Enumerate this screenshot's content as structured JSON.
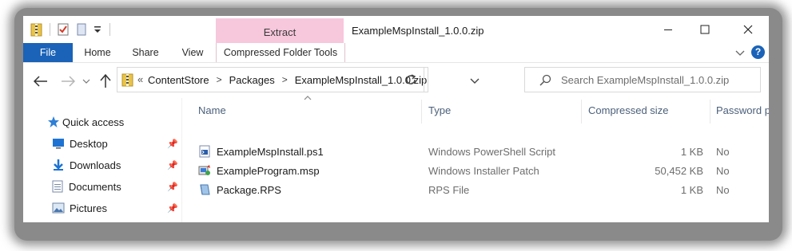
{
  "window": {
    "title": "ExampleMspInstall_1.0.0.zip",
    "context_tab_label": "Extract"
  },
  "ribbon": {
    "tabs": [
      "File",
      "Home",
      "Share",
      "View",
      "Compressed Folder Tools"
    ]
  },
  "address": {
    "overflow": "«",
    "crumbs": [
      "ContentStore",
      "Packages",
      "ExampleMspInstall_1.0.0.zip"
    ]
  },
  "search": {
    "placeholder": "Search ExampleMspInstall_1.0.0.zip"
  },
  "nav": {
    "items": [
      {
        "label": "Quick access",
        "icon": "star-icon"
      },
      {
        "label": "Desktop",
        "icon": "desktop-icon",
        "pinned": true
      },
      {
        "label": "Downloads",
        "icon": "download-icon",
        "pinned": true
      },
      {
        "label": "Documents",
        "icon": "documents-icon",
        "pinned": true
      },
      {
        "label": "Pictures",
        "icon": "pictures-icon",
        "pinned": true
      }
    ]
  },
  "columns": [
    "Name",
    "Type",
    "Compressed size",
    "Password p"
  ],
  "files": [
    {
      "name": "ExampleMspInstall.ps1",
      "type": "Windows PowerShell Script",
      "size": "1 KB",
      "password": "No",
      "icon": "powershell-file-icon"
    },
    {
      "name": "ExampleProgram.msp",
      "type": "Windows Installer Patch",
      "size": "50,452 KB",
      "password": "No",
      "icon": "installer-patch-icon"
    },
    {
      "name": "Package.RPS",
      "type": "RPS File",
      "size": "1 KB",
      "password": "No",
      "icon": "generic-file-icon"
    }
  ],
  "colors": {
    "file_tab": "#1a63b8",
    "extract_tab": "#f7c7dc",
    "column_header": "#4c607a",
    "help": "#1a63b8"
  }
}
